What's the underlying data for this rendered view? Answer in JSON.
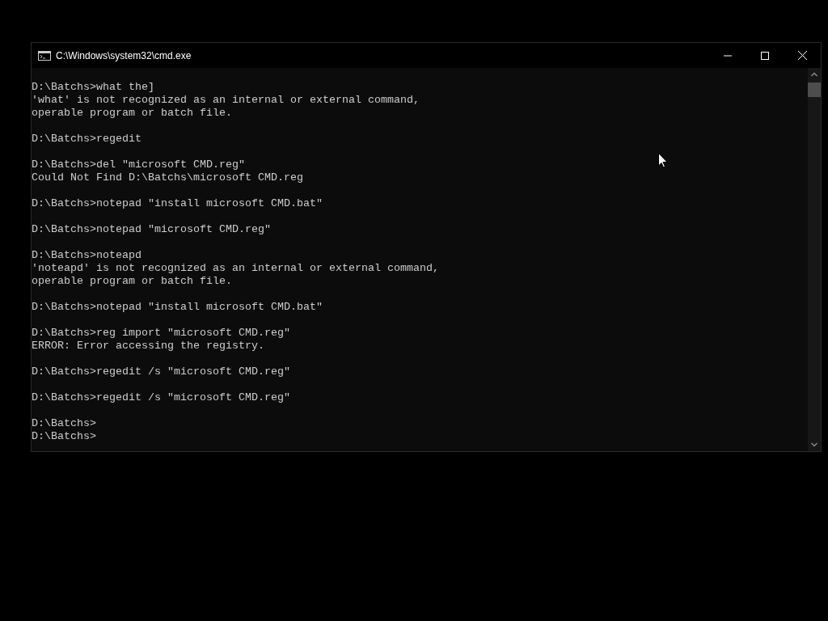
{
  "window": {
    "title": "C:\\Windows\\system32\\cmd.exe"
  },
  "console": {
    "blocks": [
      [
        "D:\\Batchs>what the]",
        "'what' is not recognized as an internal or external command,",
        "operable program or batch file."
      ],
      [
        "D:\\Batchs>regedit"
      ],
      [
        "D:\\Batchs>del \"microsoft CMD.reg\"",
        "Could Not Find D:\\Batchs\\microsoft CMD.reg"
      ],
      [
        "D:\\Batchs>notepad \"install microsoft CMD.bat\""
      ],
      [
        "D:\\Batchs>notepad \"microsoft CMD.reg\""
      ],
      [
        "D:\\Batchs>noteapd",
        "'noteapd' is not recognized as an internal or external command,",
        "operable program or batch file."
      ],
      [
        "D:\\Batchs>notepad \"install microsoft CMD.bat\""
      ],
      [
        "D:\\Batchs>reg import \"microsoft CMD.reg\"",
        "ERROR: Error accessing the registry."
      ],
      [
        "D:\\Batchs>regedit /s \"microsoft CMD.reg\""
      ],
      [
        "D:\\Batchs>regedit /s \"microsoft CMD.reg\""
      ],
      [
        "D:\\Batchs>",
        "D:\\Batchs>"
      ]
    ]
  }
}
